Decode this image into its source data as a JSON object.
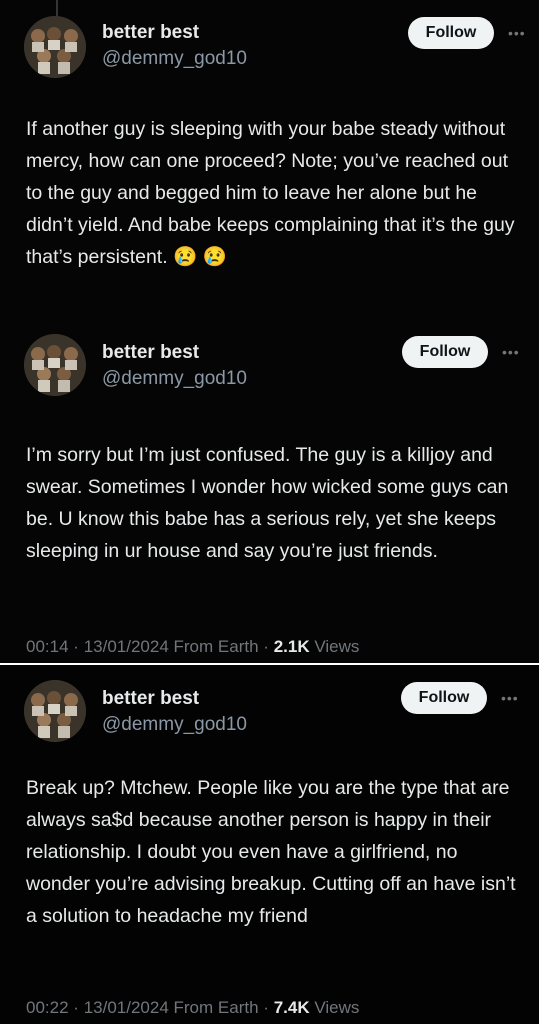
{
  "posts": [
    {
      "display_name": "better best",
      "handle": "@demmy_god10",
      "follow_label": "Follow",
      "text": "If another guy is sleeping with your babe steady without mercy, how can one proceed? Note; you’ve reached out to the guy and begged him to leave her alone but he didn’t yield. And babe keeps complaining that it’s the guy that’s persistent. 😢 😢"
    },
    {
      "display_name": "better best",
      "handle": "@demmy_god10",
      "follow_label": "Follow",
      "text": "I’m sorry but I’m just confused. The guy is a killjoy and swear. Sometimes I wonder how wicked some guys can be. U know this babe has a serious rely, yet she keeps sleeping in ur house and say you’re just friends.",
      "time": "00:14",
      "date": "13/01/2024",
      "source": "From Earth",
      "views_count": "2.1K",
      "views_label": "Views"
    },
    {
      "display_name": "better best",
      "handle": "@demmy_god10",
      "follow_label": "Follow",
      "text": "Break up? Mtchew. People like you are the type that are always sa$d because another person is happy in their relationship. I doubt you even have a girlfriend, no wonder you’re advising breakup. Cutting off an have isn’t a solution to headache my friend",
      "time": "00:22",
      "date": "13/01/2024",
      "source": "From Earth",
      "views_count": "7.4K",
      "views_label": "Views"
    }
  ],
  "meta_separator": "·",
  "icons": {
    "more": "more-dots-icon",
    "avatar": "avatar-photo"
  },
  "colors": {
    "background": "#000000",
    "text": "#e7e9ea",
    "secondary": "#71767b",
    "follow_bg": "#eff3f4"
  }
}
